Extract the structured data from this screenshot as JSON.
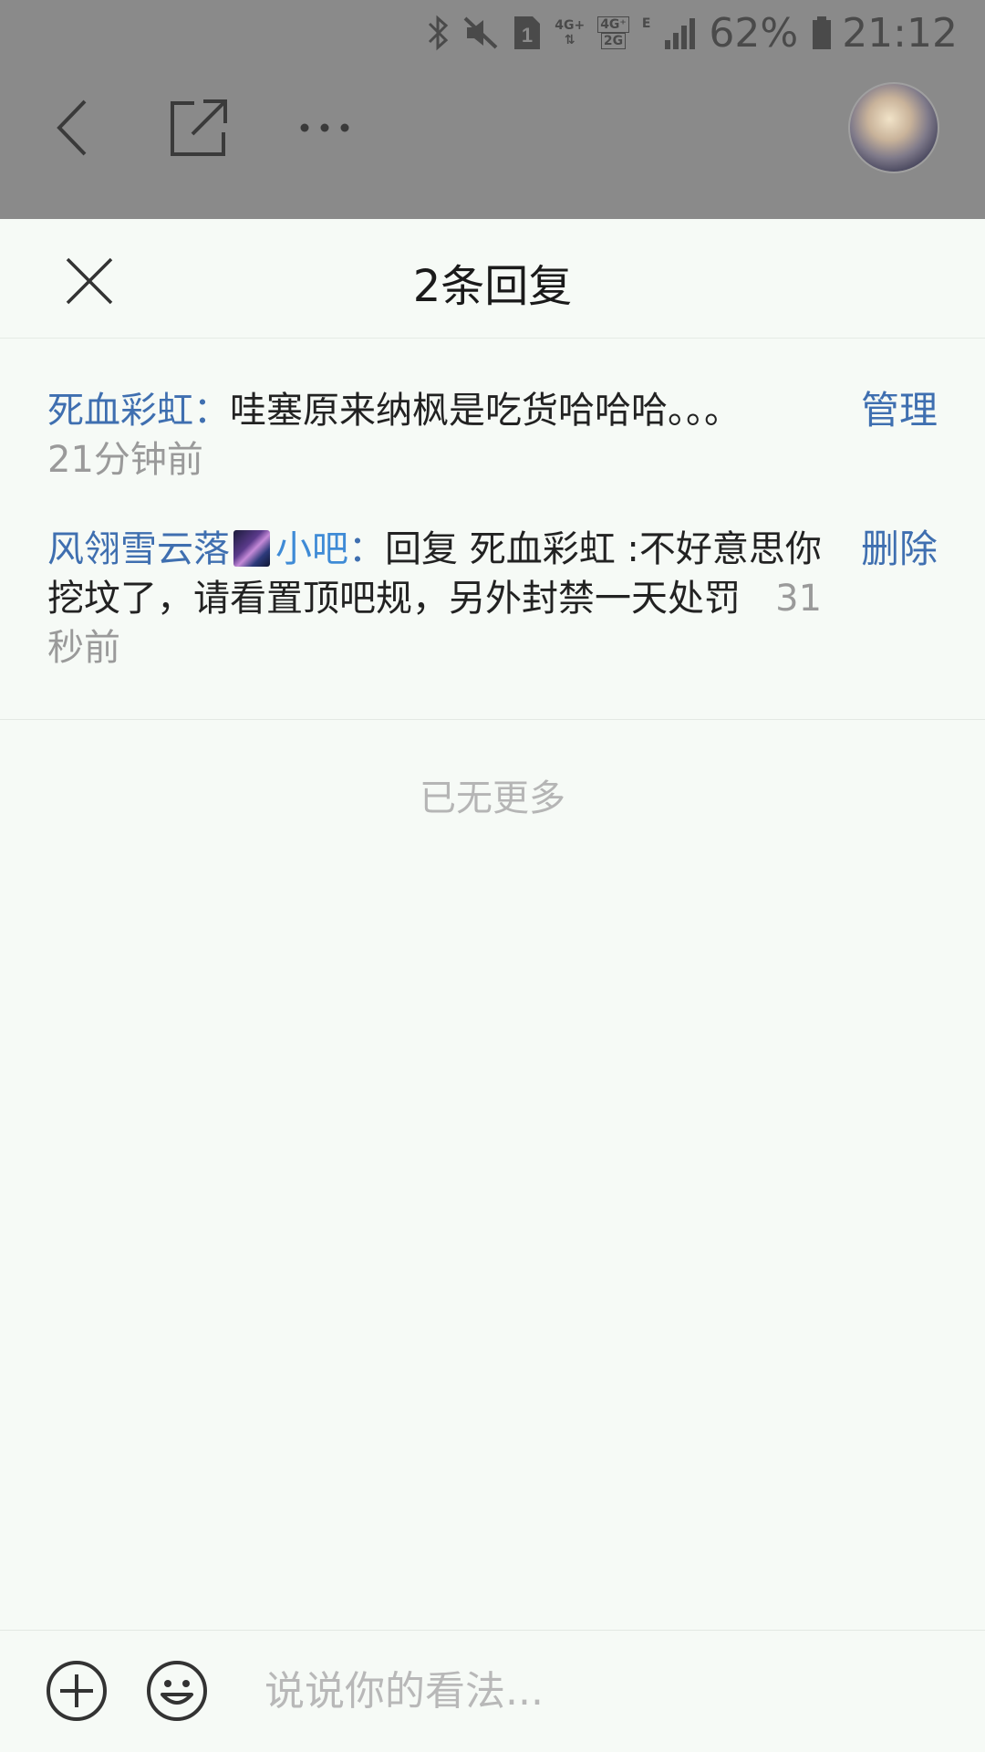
{
  "status_bar": {
    "battery_percent": "62%",
    "time": "21:12",
    "sim_badge": "1",
    "network_top": "4G+",
    "network_dual_top": "4G⁺",
    "network_dual_bottom": "2G",
    "edge_label": "E",
    "icons": [
      "bluetooth-icon",
      "mute-icon",
      "sim-icon",
      "network-icon",
      "signal-icon",
      "battery-icon"
    ]
  },
  "nav": {
    "icons": [
      "back-icon",
      "share-icon",
      "more-icon"
    ]
  },
  "sheet": {
    "title": "2条回复",
    "replies": [
      {
        "author": "死血彩虹",
        "separator": "：",
        "text": "哇塞原来纳枫是吃货哈哈哈。。。",
        "time": "21分钟前",
        "action": "管理"
      },
      {
        "author": "风翎雪云落",
        "badge": "小吧",
        "separator": "：",
        "text": "回复 死血彩虹 :不好意思你挖坟了，请看置顶吧规，另外封禁一天处罚",
        "time": "31秒前",
        "action": "删除"
      }
    ],
    "no_more": "已无更多"
  },
  "composer": {
    "placeholder": "说说你的看法..."
  },
  "colors": {
    "link_blue": "#3f6fb0",
    "badge_blue": "#3f8bd6",
    "dim_overlay": "#8a8a8a",
    "sheet_bg": "#f6faf6"
  }
}
